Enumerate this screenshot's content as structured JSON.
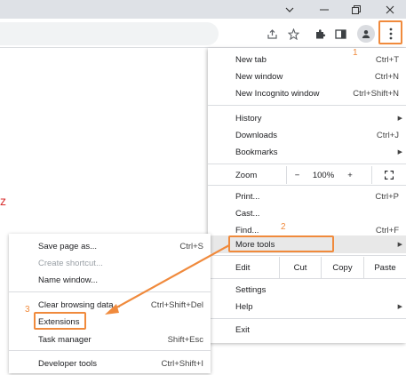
{
  "accent_color": "#f08a3c",
  "window_controls": {
    "tab_search": "tab-search-icon",
    "minimize": "minimize-icon",
    "restore": "restore-icon",
    "close": "close-icon"
  },
  "toolbar_icons": [
    "share-icon",
    "star-icon",
    "extensions-puzzle-icon",
    "side-panel-icon",
    "profile-icon",
    "kebab-menu-icon"
  ],
  "page": {
    "mark": "z"
  },
  "menu": {
    "new_tab": {
      "label": "New tab",
      "shortcut": "Ctrl+T"
    },
    "new_window": {
      "label": "New window",
      "shortcut": "Ctrl+N"
    },
    "incognito": {
      "label": "New Incognito window",
      "shortcut": "Ctrl+Shift+N"
    },
    "history": {
      "label": "History"
    },
    "downloads": {
      "label": "Downloads",
      "shortcut": "Ctrl+J"
    },
    "bookmarks": {
      "label": "Bookmarks"
    },
    "zoom": {
      "label": "Zoom",
      "minus": "−",
      "value": "100%",
      "plus": "+"
    },
    "print": {
      "label": "Print...",
      "shortcut": "Ctrl+P"
    },
    "cast": {
      "label": "Cast..."
    },
    "find": {
      "label": "Find...",
      "shortcut": "Ctrl+F"
    },
    "more_tools": {
      "label": "More tools"
    },
    "edit": {
      "label": "Edit",
      "cut": "Cut",
      "copy": "Copy",
      "paste": "Paste"
    },
    "settings": {
      "label": "Settings"
    },
    "help": {
      "label": "Help"
    },
    "exit": {
      "label": "Exit"
    }
  },
  "submenu": {
    "save_page": {
      "label": "Save page as...",
      "shortcut": "Ctrl+S"
    },
    "create_shortcut": {
      "label": "Create shortcut..."
    },
    "name_window": {
      "label": "Name window..."
    },
    "clear_data": {
      "label": "Clear browsing data...",
      "shortcut": "Ctrl+Shift+Del"
    },
    "extensions": {
      "label": "Extensions"
    },
    "task_manager": {
      "label": "Task manager",
      "shortcut": "Shift+Esc"
    },
    "dev_tools": {
      "label": "Developer tools",
      "shortcut": "Ctrl+Shift+I"
    }
  },
  "step_badges": {
    "one": "1",
    "two": "2",
    "three": "3"
  }
}
